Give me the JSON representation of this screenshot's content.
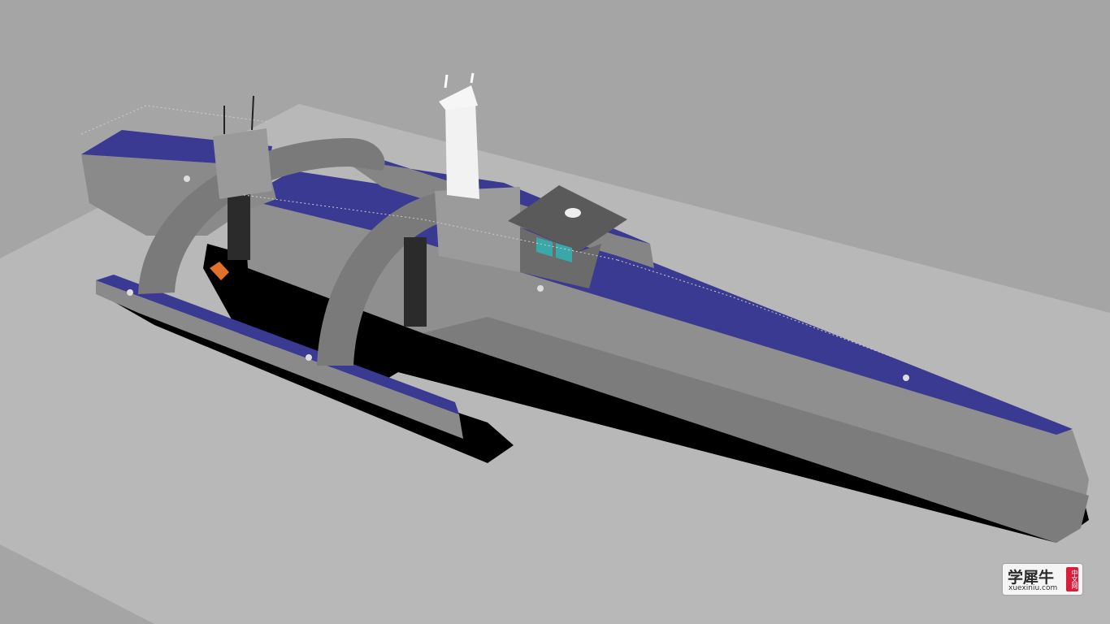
{
  "scene": {
    "subject": "trimaran-hull-3d-model",
    "colors": {
      "background": "#a5a5a5",
      "floor": "#b8b8b8",
      "hull": "#8f8f8f",
      "hull_dark": "#6d6d6d",
      "deck": "#3a3a92",
      "shadow": "#000000",
      "mast": "#f2f2f2"
    }
  },
  "watermark": {
    "brand_cn": "学犀牛",
    "url": "xuexiniu.com",
    "badge": "中文网"
  }
}
